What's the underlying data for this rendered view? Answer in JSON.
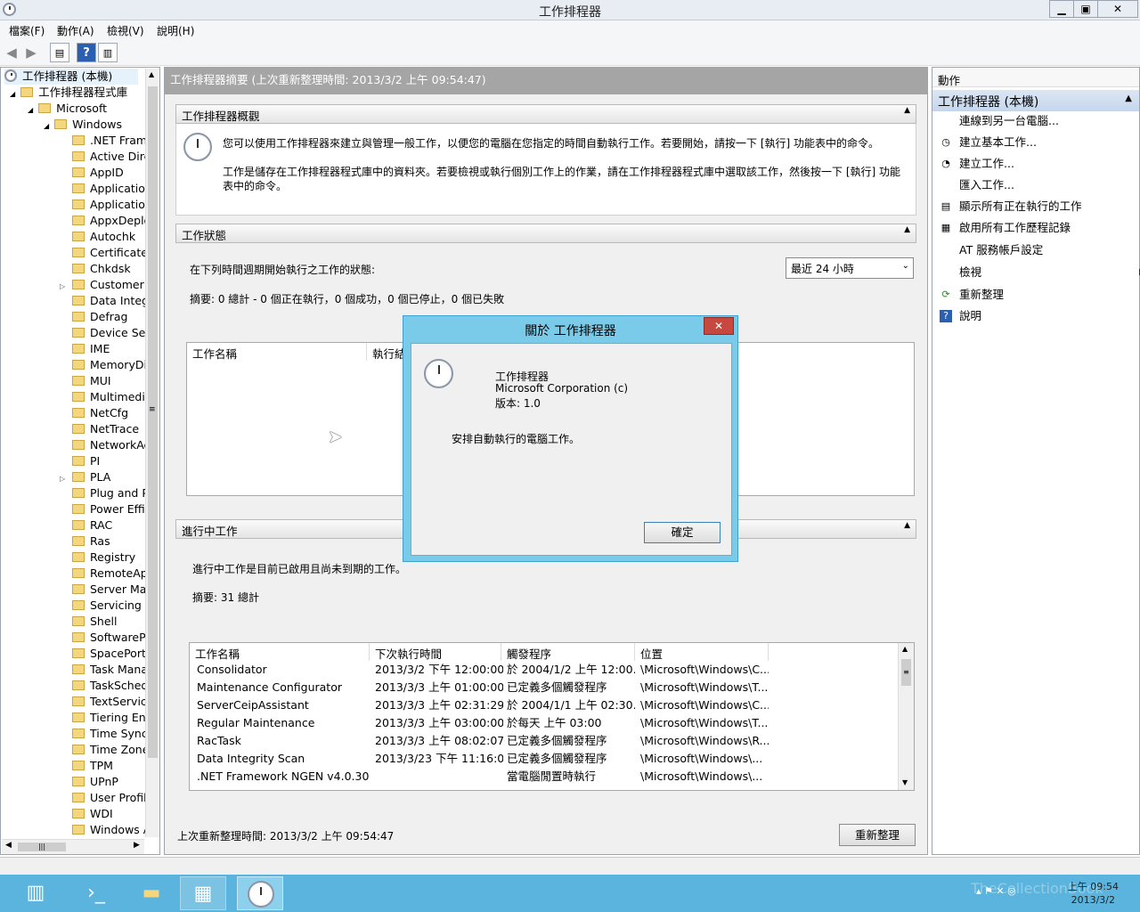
{
  "window": {
    "title": "工作排程器",
    "btn_min": "▁",
    "btn_restore": "▣",
    "btn_close": "✕"
  },
  "menu": [
    "檔案(F)",
    "動作(A)",
    "檢視(V)",
    "說明(H)"
  ],
  "toolbar": {
    "back": "◀",
    "forward": "▶",
    "help": "?"
  },
  "tree": {
    "root": "工作排程器 (本機)",
    "library": "工作排程器程式庫",
    "microsoft": "Microsoft",
    "windows": "Windows",
    "folders": [
      ".NET Framework",
      "Active Directory",
      "AppID",
      "Application",
      "Application",
      "AppxDeploy",
      "Autochk",
      "Certificate",
      "Chkdsk",
      "Customer Experience",
      "Data Integrity",
      "Defrag",
      "Device Setup",
      "IME",
      "MemoryDiagnostic",
      "MUI",
      "Multimedia",
      "NetCfg",
      "NetTrace",
      "NetworkAccess",
      "PI",
      "PLA",
      "Plug and Play",
      "Power Efficiency",
      "RAC",
      "Ras",
      "Registry",
      "RemoteApp",
      "Server Manager",
      "Servicing",
      "Shell",
      "SoftwareProtection",
      "SpacePort",
      "Task Manager",
      "TaskScheduler",
      "TextServices",
      "Tiering Engine",
      "Time Synchronization",
      "Time Zone",
      "TPM",
      "UPnP",
      "User Profile",
      "WDI",
      "Windows Activation"
    ]
  },
  "center": {
    "header": "工作排程器摘要 (上次重新整理時間: 2013/3/2 上午 09:54:47)",
    "overview": {
      "title": "工作排程器概觀",
      "p1": "您可以使用工作排程器來建立與管理一般工作，以便您的電腦在您指定的時間自動執行工作。若要開始，請按一下 [執行] 功能表中的命令。",
      "p2a": "工作是儲存在工作排程器程式庫中的資料夾。若要檢視或執行個別工作上的作業，請在工作排程器程式庫中選取該工作，然後按一下 [執行] 功能",
      "p2b": "表中的命令。"
    },
    "status": {
      "title": "工作狀態",
      "label": "在下列時間週期開始執行之工作的狀態:",
      "period": "最近 24 小時",
      "summary": "摘要: 0 總計 - 0 個正在執行，0 個成功，0 個已停止，0 個已失敗",
      "cols": [
        "工作名稱",
        "執行結果"
      ]
    },
    "active": {
      "title": "進行中工作",
      "desc": "進行中工作是目前已啟用且尚未到期的工作。",
      "summary": "摘要: 31 總計",
      "cols": [
        "工作名稱",
        "下次執行時間",
        "觸發程序",
        "位置"
      ],
      "rows": [
        [
          "Consolidator",
          "2013/3/2 下午 12:00:00",
          "於 2004/1/2 上午 12:00...",
          "\\Microsoft\\Windows\\C..."
        ],
        [
          "Maintenance Configurator",
          "2013/3/3 上午 01:00:00",
          "已定義多個觸發程序",
          "\\Microsoft\\Windows\\T..."
        ],
        [
          "ServerCeipAssistant",
          "2013/3/3 上午 02:31:29",
          "於 2004/1/1 上午 02:30...",
          "\\Microsoft\\Windows\\C..."
        ],
        [
          "Regular Maintenance",
          "2013/3/3 上午 03:00:00",
          "於每天 上午 03:00",
          "\\Microsoft\\Windows\\T..."
        ],
        [
          "RacTask",
          "2013/3/3 上午 08:02:07",
          "已定義多個觸發程序",
          "\\Microsoft\\Windows\\R..."
        ],
        [
          "Data Integrity Scan",
          "2013/3/23 下午 11:16:00",
          "已定義多個觸發程序",
          "\\Microsoft\\Windows\\..."
        ],
        [
          ".NET Framework NGEN v4.0.303...",
          "",
          "當電腦閒置時執行",
          "\\Microsoft\\Windows\\..."
        ]
      ]
    },
    "footer": "上次重新整理時間: 2013/3/2 上午 09:54:47",
    "refresh": "重新整理"
  },
  "actions": {
    "header": "動作",
    "group": "工作排程器 (本機)",
    "items": [
      "連線到另一台電腦...",
      "建立基本工作...",
      "建立工作...",
      "匯入工作...",
      "顯示所有正在執行的工作",
      "啟用所有工作歷程記錄",
      "AT 服務帳戶設定",
      "檢視",
      "重新整理",
      "說明"
    ]
  },
  "dialog": {
    "title": "關於 工作排程器",
    "close": "✕",
    "name": "工作排程器",
    "company": "Microsoft Corporation (c)",
    "version": "版本: 1.0",
    "desc": "安排自動執行的電腦工作。",
    "ok": "確定"
  },
  "tray": {
    "time": "上午 09:54",
    "date": "2013/3/2"
  },
  "watermark": "TheCollectionBook",
  "colors": {
    "taskbar": "#5bb4dd",
    "dialog_frame": "#79cbe9",
    "center_header": "#a5a5a5"
  }
}
